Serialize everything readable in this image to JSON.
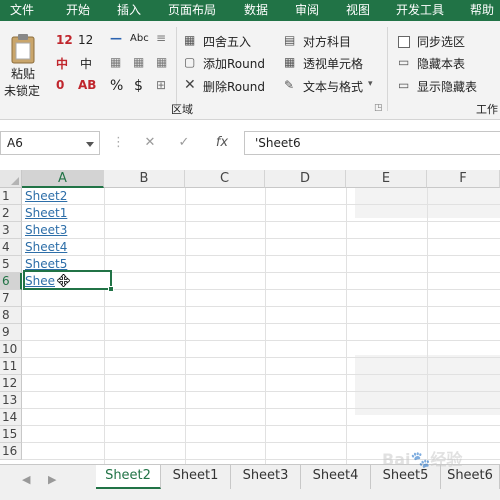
{
  "menu": {
    "items": [
      "文件",
      "开始",
      "插入",
      "页面布局",
      "数据",
      "审阅",
      "视图",
      "开发工具",
      "帮助"
    ]
  },
  "ribbon": {
    "paste_label": "粘贴",
    "unlock_label": "未锁定",
    "number_12": "12",
    "char_zhong_1": "中",
    "char_zhong_2": "中",
    "char_AB": "AB",
    "abc_label": "Abc",
    "percent": "%",
    "dollar": "$",
    "round_label": "四舍五入",
    "add_round_label": "添加Round",
    "remove_round_label": "删除Round",
    "group_label": "区域",
    "align_label": "对方科目",
    "perspective_label": "透视单元格",
    "text_format_label": "文本与格式",
    "sync_select_label": "同步选区",
    "hide_sheet_label": "隐藏本表",
    "show_hidden_label": "显示隐藏表",
    "work_label": "工作"
  },
  "formula_bar": {
    "name_box": "A6",
    "cancel_symbol": "✕",
    "enter_symbol": "✓",
    "fx_symbol": "fx",
    "formula": "'Sheet6"
  },
  "grid": {
    "columns": [
      "A",
      "B",
      "C",
      "D",
      "E",
      "F"
    ],
    "rows": [
      "1",
      "2",
      "3",
      "4",
      "5",
      "6",
      "7",
      "8",
      "9",
      "10",
      "11",
      "12",
      "13",
      "14",
      "15",
      "16"
    ],
    "cells": [
      "Sheet2",
      "Sheet1",
      "Sheet3",
      "Sheet4",
      "Sheet5",
      "Shee"
    ]
  },
  "sheet_tabs": [
    "Sheet2",
    "Sheet1",
    "Sheet3",
    "Sheet4",
    "Sheet5",
    "Sheet6"
  ],
  "active_sheet": "Sheet2",
  "colors": {
    "accent": "#217346",
    "link": "#2d6ea8",
    "red_icon": "#c0262d"
  },
  "icons": [
    "clipboard-icon",
    "table-icon",
    "cancel-icon",
    "enter-icon",
    "function-icon",
    "move-cursor-icon"
  ]
}
